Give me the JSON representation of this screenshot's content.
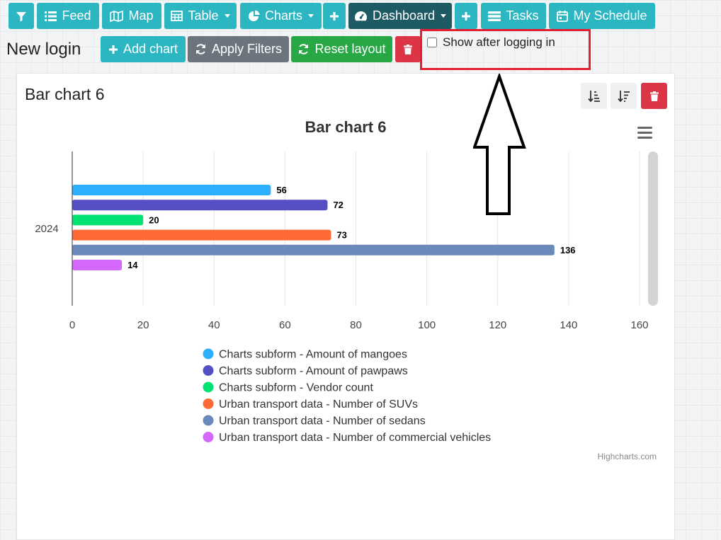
{
  "toolbar": {
    "feed": "Feed",
    "map": "Map",
    "table": "Table",
    "charts": "Charts",
    "dashboard": "Dashboard",
    "tasks": "Tasks",
    "schedule": "My Schedule"
  },
  "dashboard_bar": {
    "title": "New login",
    "add_chart": "Add chart",
    "apply_filters": "Apply Filters",
    "reset_layout": "Reset layout",
    "show_after_login": "Show after logging in",
    "show_after_login_checked": false
  },
  "card": {
    "title": "Bar chart 6",
    "credit": "Highcharts.com"
  },
  "chart_data": {
    "type": "bar",
    "orientation": "horizontal",
    "title": "Bar chart 6",
    "categories": [
      "2024"
    ],
    "xlim": [
      0,
      160
    ],
    "ticks": [
      0,
      20,
      40,
      60,
      80,
      100,
      120,
      140,
      160
    ],
    "grid": true,
    "legend": "bottom",
    "series": [
      {
        "name": "Charts subform - Amount of mangoes",
        "values": [
          56
        ],
        "color": "#2caffe"
      },
      {
        "name": "Charts subform - Amount of pawpaws",
        "values": [
          72
        ],
        "color": "#544fc5"
      },
      {
        "name": "Charts subform - Vendor count",
        "values": [
          20
        ],
        "color": "#00e272"
      },
      {
        "name": "Urban transport data - Number of SUVs",
        "values": [
          73
        ],
        "color": "#fe6a35"
      },
      {
        "name": "Urban transport data - Number of sedans",
        "values": [
          136
        ],
        "color": "#6b8abc"
      },
      {
        "name": "Urban transport data - Number of commercial vehicles",
        "values": [
          14
        ],
        "color": "#d568fb"
      }
    ]
  }
}
